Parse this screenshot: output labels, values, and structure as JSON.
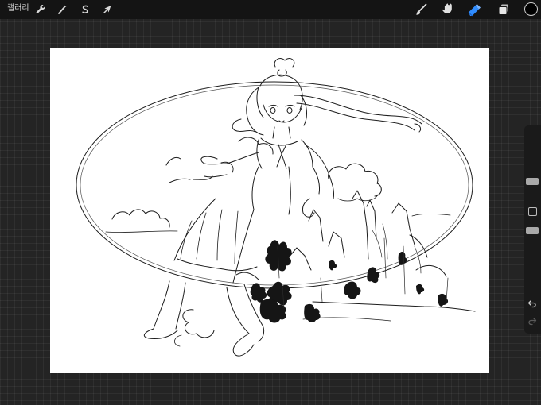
{
  "topbar": {
    "gallery_label": "갤러리",
    "left_tools": [
      {
        "name": "actions",
        "icon": "wrench-icon"
      },
      {
        "name": "adjustments",
        "icon": "magic-wand-icon"
      },
      {
        "name": "selection",
        "icon": "selection-s-icon"
      },
      {
        "name": "transform",
        "icon": "arrow-cursor-icon"
      }
    ],
    "right_tools": [
      {
        "name": "brush",
        "icon": "brush-icon",
        "active": false
      },
      {
        "name": "smudge",
        "icon": "smudge-finger-icon",
        "active": false
      },
      {
        "name": "eraser",
        "icon": "eraser-icon",
        "active": true
      },
      {
        "name": "layers",
        "icon": "layers-icon",
        "active": false
      }
    ],
    "current_color": "#000000"
  },
  "sidebar": {
    "brush_size_level": 0.25,
    "opacity_level": 0.55,
    "buttons": [
      "modify-square-icon",
      "undo-icon",
      "redo-icon"
    ]
  },
  "colors": {
    "accent": "#2f8cff",
    "background": "#242424",
    "topbar": "#141414",
    "canvas": "#ffffff"
  }
}
